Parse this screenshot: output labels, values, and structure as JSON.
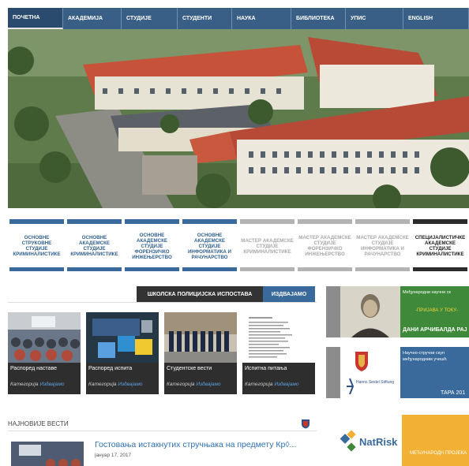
{
  "nav": {
    "items": [
      {
        "label": "ПОЧЕТНА",
        "active": true,
        "w": 70
      },
      {
        "label": "АКАДЕМИЈА",
        "active": false,
        "w": 74
      },
      {
        "label": "СТУДИЈЕ",
        "active": false,
        "w": 71
      },
      {
        "label": "СТУДЕНТИ",
        "active": false,
        "w": 69
      },
      {
        "label": "НАУКА",
        "active": false,
        "w": 75
      },
      {
        "label": "БИБЛИОТЕКА",
        "active": false,
        "w": 69
      },
      {
        "label": "УПИС",
        "active": false,
        "w": 73
      },
      {
        "label": "ENGLISH",
        "active": false,
        "w": 83
      }
    ]
  },
  "programs": [
    {
      "label": "ОСНОВНЕ СТРУКОВНЕ СТУДИЈЕ КРИМИНАЛИСТИКЕ",
      "style": "blue"
    },
    {
      "label": "ОСНОВНЕ АКАДЕМСКЕ СТУДИЈЕ КРИМИНАЛИСТИКЕ",
      "style": "blue"
    },
    {
      "label": "ОСНОВНЕ АКАДЕМСКЕ СТУДИЈЕ ФОРЕНЗИЧКО ИНЖЕЊЕРСТВО",
      "style": "blue"
    },
    {
      "label": "ОСНОВНЕ АКАДЕМСКЕ СТУДИЈЕ ИНФОРМАТИКА И РАЧУНАРСТВО",
      "style": "blue"
    },
    {
      "label": "МАСТЕР АКАДЕМСКЕ СТУДИЈЕ КРИМИНАЛИСТИКЕ",
      "style": "grey"
    },
    {
      "label": "МАСТЕР АКАДЕМСКЕ СТУДИЈЕ ФОРЕНЗИЧКО ИНЖЕЊЕРСТВО",
      "style": "grey"
    },
    {
      "label": "МАСТЕР АКАДЕМСКЕ СТУДИЈЕ ИНФОРМАТИКА И РАЧУНАРСТВО",
      "style": "grey"
    },
    {
      "label": "СПЕЦИЈАЛИСТИЧКЕ АКАДЕМСКЕ СТУДИЈЕ КРИМИНАЛИСТИКЕ",
      "style": "dark"
    }
  ],
  "tabs": {
    "tab1": "ШКОЛСКА ПОЛИЦИЈСКА ИСПОСТАВА",
    "tab2": "ИЗДВАЈАМО"
  },
  "cards": [
    {
      "title": "Распоред наставе",
      "cat_label": "Категорија",
      "cat_value": "Издвајамо"
    },
    {
      "title": "Распоред испита",
      "cat_label": "Категорија",
      "cat_value": "Издвајамо"
    },
    {
      "title": "Студентске вести",
      "cat_label": "Категорија",
      "cat_value": "Издвајамо"
    },
    {
      "title": "Испитна питања",
      "cat_label": "Категорија",
      "cat_value": "Издвајамо"
    }
  ],
  "news": {
    "heading": "НАЈНОВИЈЕ ВЕСТИ",
    "item_title": "Гостовања истакнутих стручњака на предмету Кр◊...",
    "item_date": "јануар 17, 2017"
  },
  "banners": {
    "b1_line1": "Међународни научни ск",
    "b1_line2": "-ПРИЈАВА У ТОКУ-",
    "b1_line3": "ДАНИ АРЧИБАЛДА РАЈ",
    "b2_line1": "Научно-стручни скуп",
    "b2_line2": "међународним учешћ",
    "b2_brand": "Hanns Seidel Stiftung",
    "b2_year": "ТАРА 201",
    "b3_brand": "NatRisk",
    "b3_text": "МЕЂУНАРОДН ПРОЈЕКА"
  },
  "colors": {
    "nav": "#3a5f86",
    "blue_program": "#3a6a9c",
    "grey_program": "#b3b3b3",
    "dark": "#2b2b2b",
    "link": "#2f6fb0",
    "banner_green": "#3e8a3a",
    "banner_blue": "#3a6a9c",
    "banner_orange": "#f2b134"
  }
}
